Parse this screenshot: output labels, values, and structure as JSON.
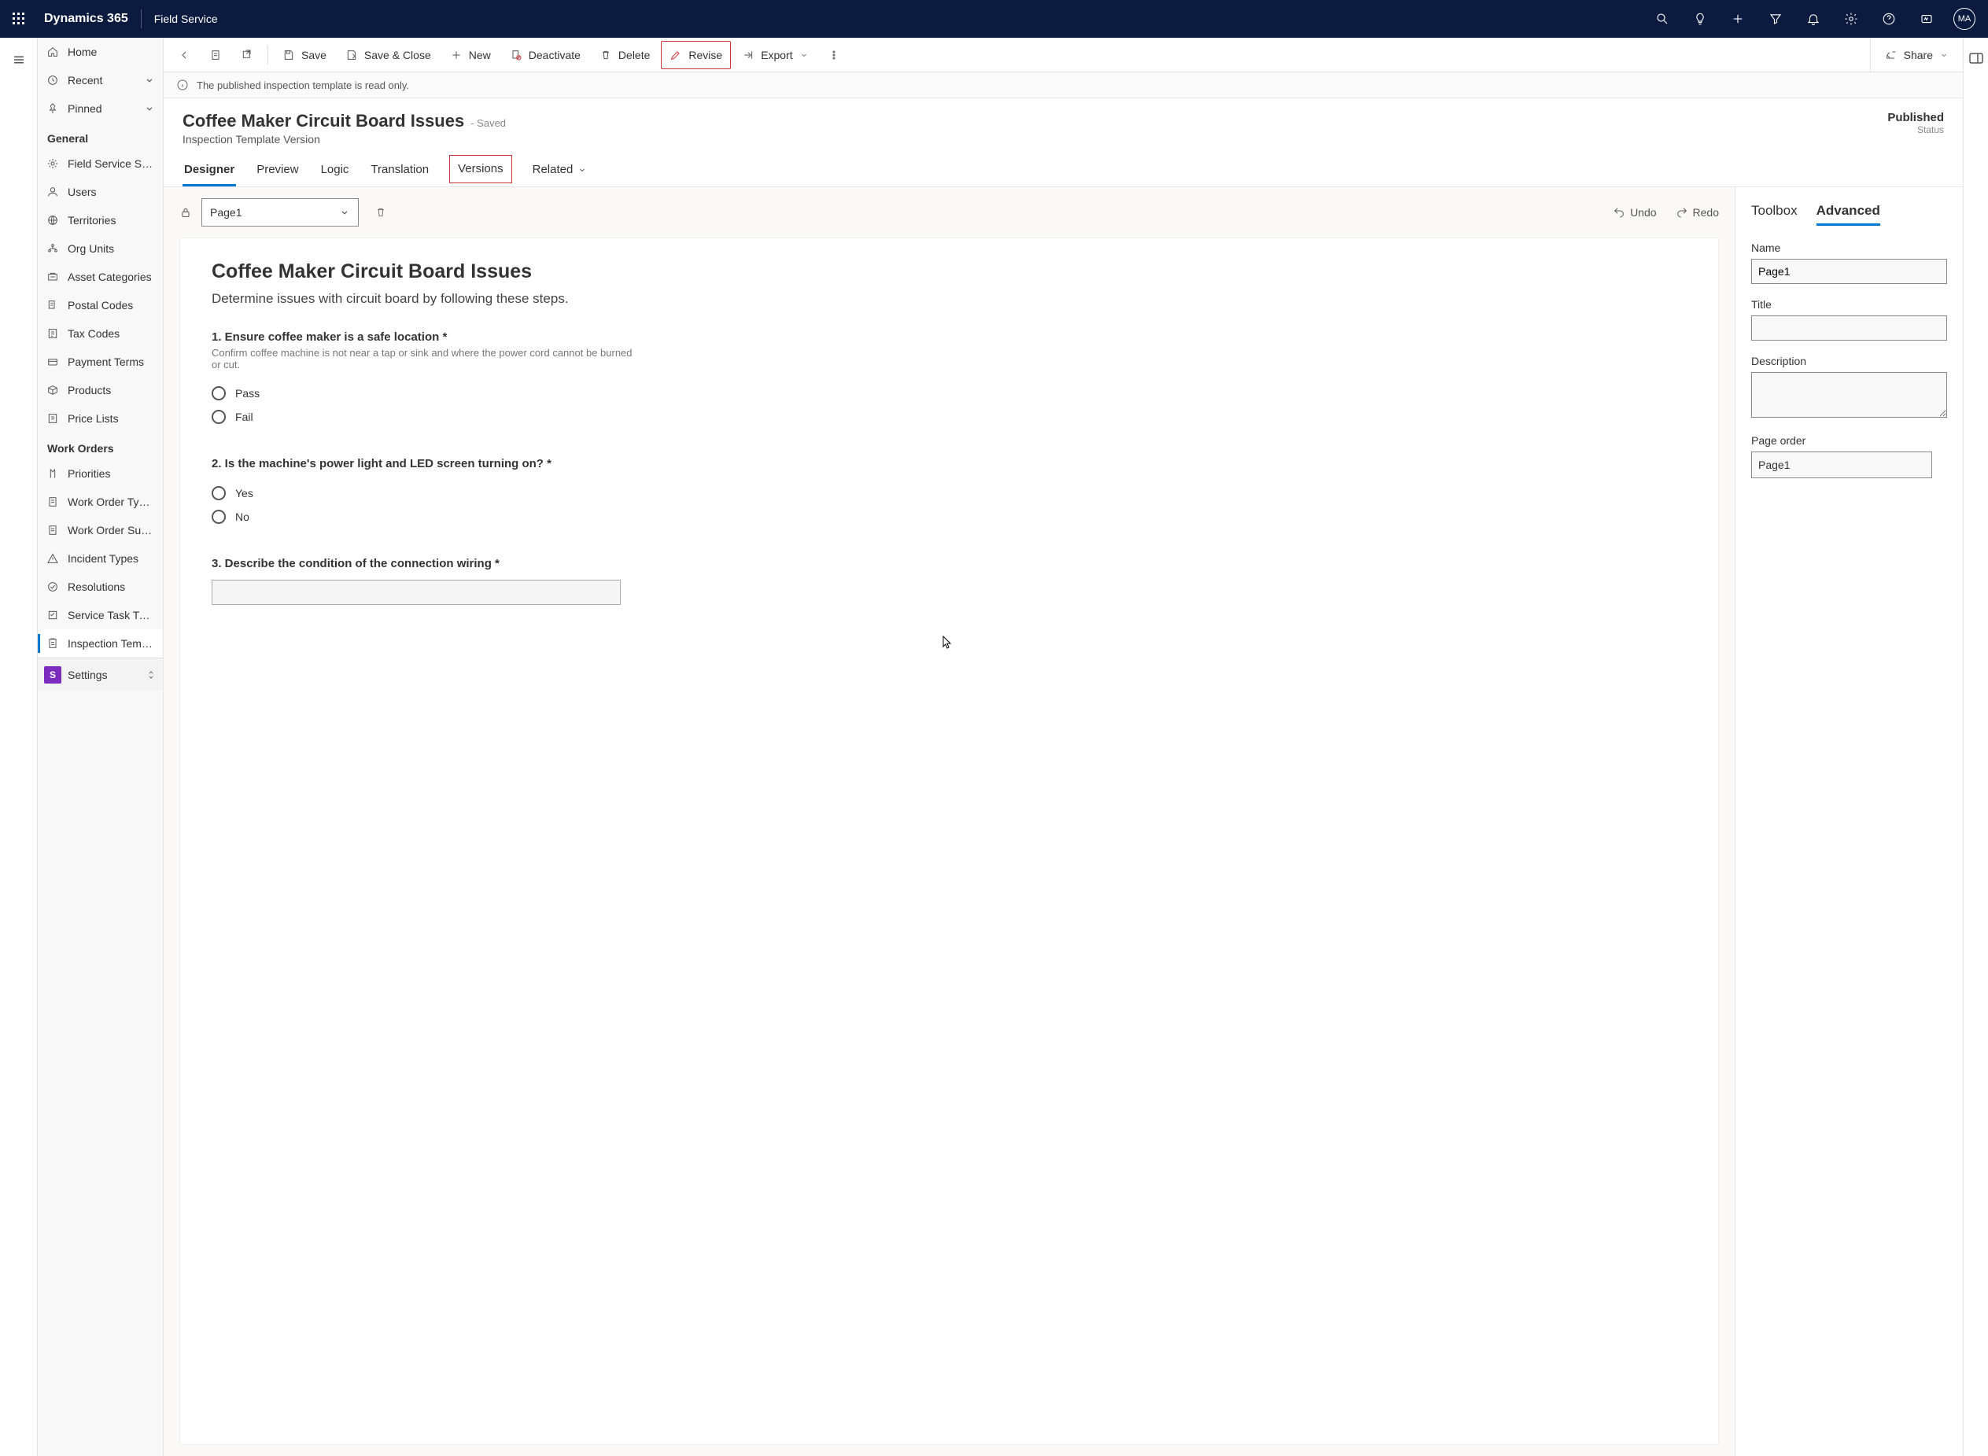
{
  "topbar": {
    "brand": "Dynamics 365",
    "service": "Field Service",
    "avatar": "MA"
  },
  "sidebar": {
    "top": [
      {
        "label": "Home",
        "icon": "home"
      },
      {
        "label": "Recent",
        "icon": "clock",
        "chevron": true
      },
      {
        "label": "Pinned",
        "icon": "pin",
        "chevron": true
      }
    ],
    "sections": [
      {
        "title": "General",
        "items": [
          {
            "label": "Field Service Setti...",
            "icon": "gear"
          },
          {
            "label": "Users",
            "icon": "user"
          },
          {
            "label": "Territories",
            "icon": "globe"
          },
          {
            "label": "Org Units",
            "icon": "org"
          },
          {
            "label": "Asset Categories",
            "icon": "asset"
          },
          {
            "label": "Postal Codes",
            "icon": "postal"
          },
          {
            "label": "Tax Codes",
            "icon": "tax"
          },
          {
            "label": "Payment Terms",
            "icon": "payment"
          },
          {
            "label": "Products",
            "icon": "product"
          },
          {
            "label": "Price Lists",
            "icon": "price"
          }
        ]
      },
      {
        "title": "Work Orders",
        "items": [
          {
            "label": "Priorities",
            "icon": "priority"
          },
          {
            "label": "Work Order Types",
            "icon": "doc"
          },
          {
            "label": "Work Order Subst...",
            "icon": "doc"
          },
          {
            "label": "Incident Types",
            "icon": "warning"
          },
          {
            "label": "Resolutions",
            "icon": "check"
          },
          {
            "label": "Service Task Types",
            "icon": "task"
          },
          {
            "label": "Inspection Templa...",
            "icon": "inspection",
            "active": true
          }
        ]
      }
    ],
    "area": {
      "badge": "S",
      "label": "Settings"
    }
  },
  "commands": {
    "save": "Save",
    "saveClose": "Save & Close",
    "new": "New",
    "deactivate": "Deactivate",
    "delete": "Delete",
    "revise": "Revise",
    "export": "Export",
    "share": "Share"
  },
  "infobar": "The published inspection template is read only.",
  "record": {
    "title": "Coffee Maker Circuit Board Issues",
    "saved": "- Saved",
    "subtitle": "Inspection Template Version",
    "statusVal": "Published",
    "statusLabel": "Status"
  },
  "tabs": [
    "Designer",
    "Preview",
    "Logic",
    "Translation",
    "Versions",
    "Related"
  ],
  "activeTab": "Designer",
  "highlightTab": "Versions",
  "designer": {
    "pageSelect": "Page1",
    "undo": "Undo",
    "redo": "Redo",
    "formTitle": "Coffee Maker Circuit Board Issues",
    "formDesc": "Determine issues with circuit board by following these steps.",
    "questions": [
      {
        "num": "1.",
        "title": "Ensure coffee maker is a safe location",
        "required": true,
        "help": "Confirm coffee machine is not near a tap or sink and where the power cord cannot be burned or cut.",
        "type": "radio",
        "options": [
          "Pass",
          "Fail"
        ]
      },
      {
        "num": "2.",
        "title": "Is the machine's power light and LED screen turning on?",
        "required": true,
        "type": "radio",
        "options": [
          "Yes",
          "No"
        ]
      },
      {
        "num": "3.",
        "title": "Describe the condition of the connection wiring",
        "required": true,
        "type": "text"
      }
    ]
  },
  "props": {
    "tabs": [
      "Toolbox",
      "Advanced"
    ],
    "activeTab": "Advanced",
    "fields": {
      "nameLabel": "Name",
      "nameValue": "Page1",
      "titleLabel": "Title",
      "titleValue": "",
      "descLabel": "Description",
      "descValue": "",
      "orderLabel": "Page order",
      "orderValue": "Page1"
    }
  }
}
